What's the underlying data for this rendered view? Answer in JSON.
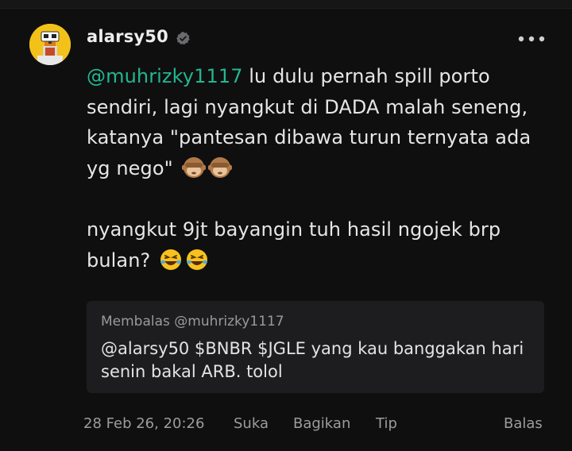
{
  "post": {
    "username": "alarsy50",
    "mention": "@muhrizky1117",
    "text_1": " lu dulu pernah spill porto sendiri, lagi nyangkut di DADA malah seneng, katanya \"pantesan dibawa turun ternyata ada yg nego\" ",
    "text_2": "nyangkut 9jt bayangin tuh hasil ngojek brp bulan? ",
    "emojis_1": [
      "see-no-evil-monkey-icon",
      "see-no-evil-monkey-icon"
    ],
    "emojis_2": [
      "rofl-face-icon",
      "rofl-face-icon"
    ]
  },
  "quote": {
    "meta": "Membalas @muhrizky1117",
    "text": "@alarsy50 $BNBR $JGLE yang kau banggakan hari senin bakal ARB. tolol"
  },
  "footer": {
    "timestamp": "28 Feb 26, 20:26",
    "like_label": "Suka",
    "share_label": "Bagikan",
    "tip_label": "Tip",
    "reply_label": "Balas"
  },
  "colors": {
    "background": "#0f0f10",
    "mention": "#22b78f",
    "quote_bg": "#1d1d1f",
    "muted": "#9c9c9f",
    "avatar": "#f2c21b"
  }
}
